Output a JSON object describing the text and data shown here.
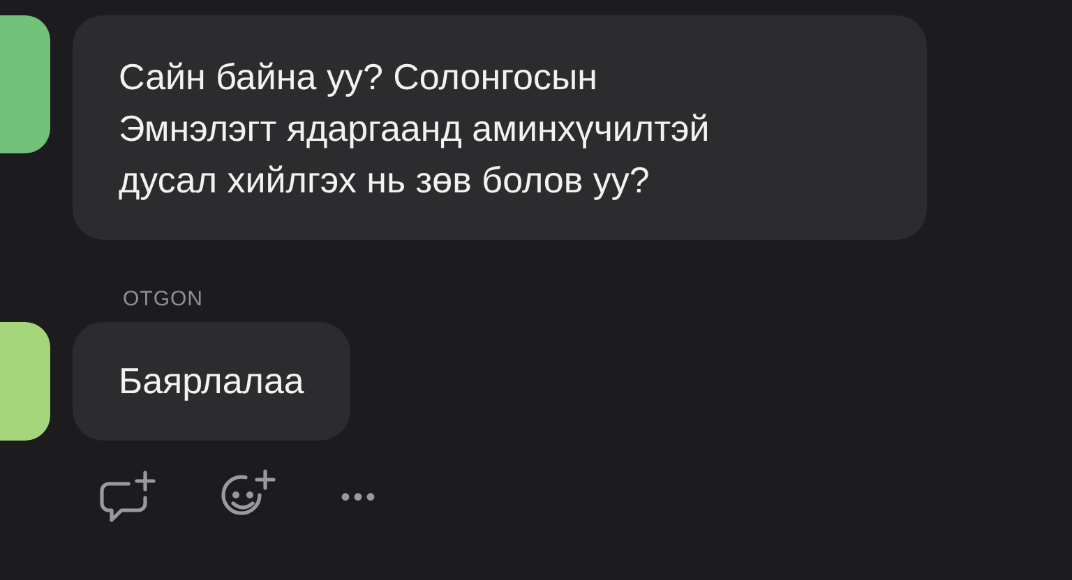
{
  "messages": [
    {
      "color": "#72c27a",
      "lines": [
        "Сайн байна уу? Солонгосын",
        "Эмнэлэгт ядаргаанд аминхүчилтэй",
        "дусал хийлгэх нь зөв болов уу?"
      ]
    },
    {
      "sender": "OTGON",
      "color": "#a6d67b",
      "lines": [
        "Баярлалаа"
      ]
    }
  ],
  "actions": [
    {
      "kind": "reply"
    },
    {
      "kind": "react"
    },
    {
      "kind": "more",
      "label": "•••"
    }
  ]
}
